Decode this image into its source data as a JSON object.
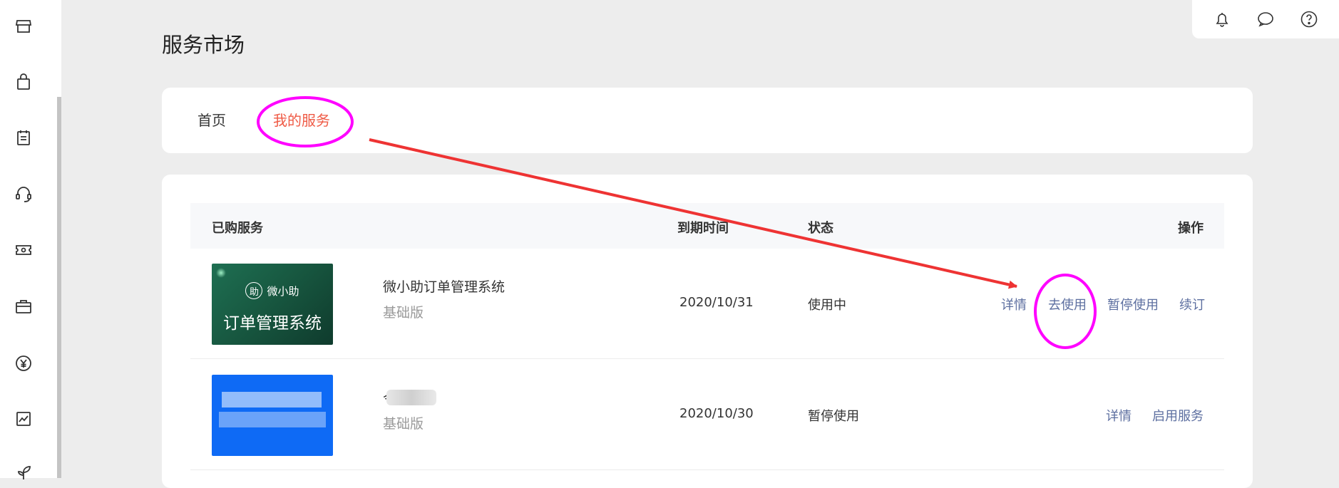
{
  "page": {
    "title": "服务市场"
  },
  "tabs": [
    {
      "label": "首页",
      "active": false
    },
    {
      "label": "我的服务",
      "active": true
    }
  ],
  "table": {
    "headers": {
      "service": "已购服务",
      "expire": "到期时间",
      "status": "状态",
      "actions": "操作"
    },
    "rows": [
      {
        "thumb_brand": "微小助",
        "thumb_brand_icon": "助",
        "thumb_title": "订单管理系统",
        "name": "微小助订单管理系统",
        "edition": "基础版",
        "expire": "2020/10/31",
        "status": "使用中",
        "actions": [
          "详情",
          "去使用",
          "暂停使用",
          "续订"
        ]
      },
      {
        "name": "令",
        "edition": "基础版",
        "expire": "2020/10/30",
        "status": "暂停使用",
        "actions": [
          "详情",
          "启用服务"
        ]
      }
    ]
  },
  "colors": {
    "accent": "#ef5a45",
    "link": "#5d6fa0",
    "annotation_circle": "#ff00ff",
    "annotation_arrow": "#ee3333"
  },
  "icons": {
    "rail": [
      "store-icon",
      "shopping-bag-icon",
      "clipboard-icon",
      "headset-icon",
      "ticket-icon",
      "briefcase-icon",
      "yuan-icon",
      "chart-icon",
      "plant-icon"
    ],
    "util": [
      "bell-icon",
      "chat-icon",
      "help-icon"
    ]
  }
}
